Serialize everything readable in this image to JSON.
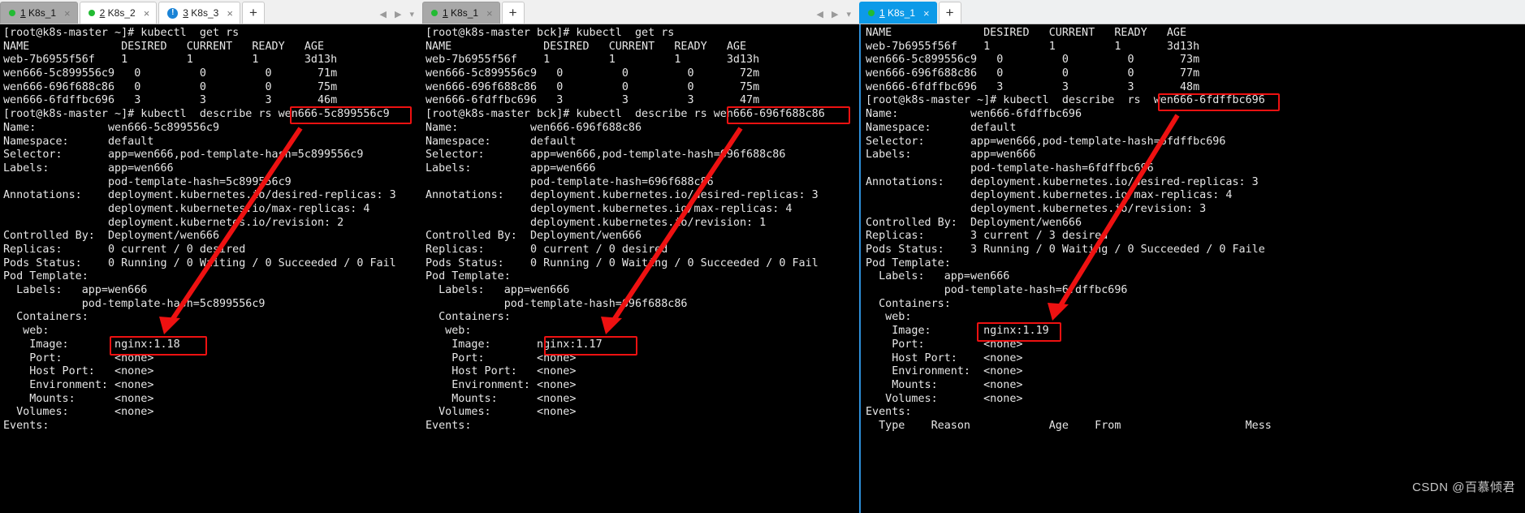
{
  "window1": {
    "tabs": [
      {
        "label": "1 K8s_1",
        "num": "1",
        "rest": " K8s_1",
        "marker": "dot",
        "active": true
      },
      {
        "label": "2 K8s_2",
        "num": "2",
        "rest": " K8s_2",
        "marker": "dot",
        "active": false
      },
      {
        "label": "3 K8s_3",
        "num": "3",
        "rest": " K8s_3",
        "marker": "badge",
        "badge_text": "!",
        "active": false
      }
    ],
    "new_tab_label": "+",
    "nav_prev": "◀",
    "nav_next": "▶",
    "nav_menu": "▾",
    "terminal_lines": [
      "[root@k8s-master ~]# kubectl  get rs",
      "NAME              DESIRED   CURRENT   READY   AGE",
      "web-7b6955f56f    1         1         1       3d13h",
      "wen666-5c899556c9   0         0         0       71m",
      "wen666-696f688c86   0         0         0       75m",
      "wen666-6fdffbc696   3         3         3       46m",
      "[root@k8s-master ~]# kubectl  describe rs wen666-5c899556c9",
      "Name:           wen666-5c899556c9",
      "Namespace:      default",
      "Selector:       app=wen666,pod-template-hash=5c899556c9",
      "Labels:         app=wen666",
      "                pod-template-hash=5c899556c9",
      "Annotations:    deployment.kubernetes.io/desired-replicas: 3",
      "                deployment.kubernetes.io/max-replicas: 4",
      "                deployment.kubernetes.io/revision: 2",
      "Controlled By:  Deployment/wen666",
      "Replicas:       0 current / 0 desired",
      "Pods Status:    0 Running / 0 Waiting / 0 Succeeded / 0 Fail",
      "Pod Template:",
      "  Labels:   app=wen666",
      "            pod-template-hash=5c899556c9",
      "  Containers:",
      "   web:",
      "    Image:       nginx:1.18",
      "    Port:        <none>",
      "    Host Port:   <none>",
      "    Environment: <none>",
      "    Mounts:      <none>",
      "  Volumes:       <none>",
      "Events:"
    ],
    "highlight_rs_name": "wen666-5c899556c9",
    "highlight_image": "nginx:1.18"
  },
  "window2": {
    "tabs": [
      {
        "label": "1 K8s_1",
        "num": "1",
        "rest": " K8s_1",
        "marker": "dot",
        "active": true
      }
    ],
    "new_tab_label": "+",
    "nav_prev": "◀",
    "nav_next": "▶",
    "nav_menu": "▾",
    "terminal_lines": [
      "[root@k8s-master bck]# kubectl  get rs",
      "NAME              DESIRED   CURRENT   READY   AGE",
      "web-7b6955f56f    1         1         1       3d13h",
      "wen666-5c899556c9   0         0         0       72m",
      "wen666-696f688c86   0         0         0       75m",
      "wen666-6fdffbc696   3         3         3       47m",
      "[root@k8s-master bck]# kubectl  describe rs wen666-696f688c86",
      "Name:           wen666-696f688c86",
      "Namespace:      default",
      "Selector:       app=wen666,pod-template-hash=696f688c86",
      "Labels:         app=wen666",
      "                pod-template-hash=696f688c86",
      "Annotations:    deployment.kubernetes.io/desired-replicas: 3",
      "                deployment.kubernetes.io/max-replicas: 4",
      "                deployment.kubernetes.io/revision: 1",
      "Controlled By:  Deployment/wen666",
      "Replicas:       0 current / 0 desired",
      "Pods Status:    0 Running / 0 Waiting / 0 Succeeded / 0 Fail",
      "Pod Template:",
      "  Labels:   app=wen666",
      "            pod-template-hash=696f688c86",
      "  Containers:",
      "   web:",
      "    Image:       nginx:1.17",
      "    Port:        <none>",
      "    Host Port:   <none>",
      "    Environment: <none>",
      "    Mounts:      <none>",
      "  Volumes:       <none>",
      "Events:"
    ],
    "highlight_rs_name": "wen666-696f688c8",
    "highlight_image": "nginx:1.17"
  },
  "window3": {
    "tabs": [
      {
        "label": "1 K8s_1",
        "num": "1",
        "rest": " K8s_1",
        "marker": "dot",
        "active": true
      }
    ],
    "new_tab_label": "+",
    "nav_prev": "◀",
    "nav_next": "▶",
    "nav_menu": "▾",
    "terminal_lines": [
      "NAME              DESIRED   CURRENT   READY   AGE",
      "web-7b6955f56f    1         1         1       3d13h",
      "wen666-5c899556c9   0         0         0       73m",
      "wen666-696f688c86   0         0         0       77m",
      "wen666-6fdffbc696   3         3         3       48m",
      "[root@k8s-master ~]# kubectl  describe  rs  wen666-6fdffbc696",
      "Name:           wen666-6fdffbc696",
      "Namespace:      default",
      "Selector:       app=wen666,pod-template-hash=6fdffbc696",
      "Labels:         app=wen666",
      "                pod-template-hash=6fdffbc696",
      "Annotations:    deployment.kubernetes.io/desired-replicas: 3",
      "                deployment.kubernetes.io/max-replicas: 4",
      "                deployment.kubernetes.io/revision: 3",
      "Controlled By:  Deployment/wen666",
      "Replicas:       3 current / 3 desired",
      "Pods Status:    3 Running / 0 Waiting / 0 Succeeded / 0 Faile",
      "Pod Template:",
      "  Labels:   app=wen666",
      "            pod-template-hash=6fdffbc696",
      "  Containers:",
      "   web:",
      "    Image:        nginx:1.19",
      "    Port:         <none>",
      "    Host Port:    <none>",
      "    Environment:  <none>",
      "    Mounts:       <none>",
      "   Volumes:       <none>",
      "Events:",
      "  Type    Reason            Age    From                   Mess"
    ],
    "highlight_rs_name": "wen666-6fdffbc696",
    "highlight_image": "nginx:1.19"
  },
  "watermark": "CSDN @百慕倾君",
  "colors": {
    "annotation": "#ee1111",
    "active_tab_blue": "#0d9ae8",
    "active_tab_grey": "#a8a8a8",
    "terminal_bg": "#000000",
    "terminal_fg": "#e6e6e6"
  }
}
